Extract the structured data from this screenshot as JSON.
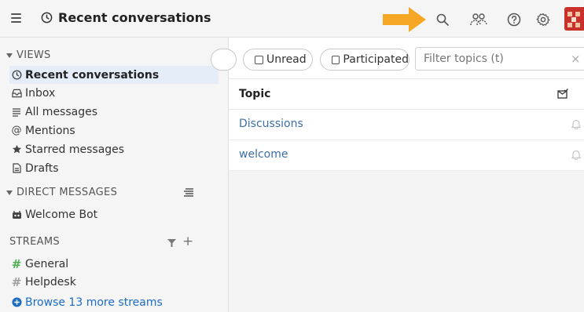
{
  "header": {
    "title": "Recent conversations",
    "icons": [
      "menu-icon",
      "clock-icon",
      "arrow-annotation",
      "search-icon",
      "users-icon",
      "help-icon",
      "gear-icon",
      "avatar"
    ]
  },
  "sidebar": {
    "views_heading": "VIEWS",
    "views": [
      {
        "label": "Recent conversations",
        "icon": "clock-icon",
        "active": true
      },
      {
        "label": "Inbox",
        "icon": "inbox-icon"
      },
      {
        "label": "All messages",
        "icon": "all-messages-icon"
      },
      {
        "label": "Mentions",
        "icon": "at-icon"
      },
      {
        "label": "Starred messages",
        "icon": "star-icon"
      },
      {
        "label": "Drafts",
        "icon": "drafts-icon"
      }
    ],
    "dm_heading": "DIRECT MESSAGES",
    "dms": [
      {
        "label": "Welcome Bot",
        "icon": "bot-icon"
      }
    ],
    "streams_heading": "STREAMS",
    "streams": [
      {
        "label": "General",
        "color": "#4caf50"
      },
      {
        "label": "Helpdesk",
        "color": "#9e9e9e"
      }
    ],
    "browse_label": "Browse 13 more streams"
  },
  "filters": {
    "unread_label": "Unread",
    "participated_label": "Participated",
    "search_placeholder": "Filter topics (t)",
    "clear": "×"
  },
  "table": {
    "header": "Topic",
    "rows": [
      "Discussions",
      "welcome"
    ]
  },
  "colors": {
    "accent": "#1d6cc4",
    "arrow": "#f5a623",
    "active_bg": "#e4edf8"
  }
}
